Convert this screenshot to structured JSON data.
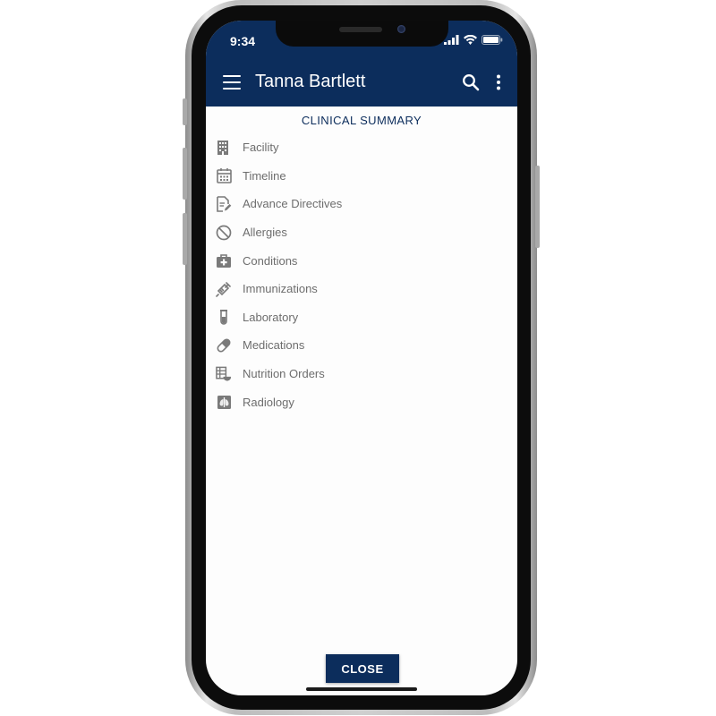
{
  "status_bar": {
    "time": "9:34"
  },
  "app_bar": {
    "title": "Tanna Bartlett",
    "menu_icon": "menu-icon",
    "search_icon": "search-icon",
    "more_icon": "more-vertical-icon"
  },
  "section": {
    "title": "CLINICAL SUMMARY",
    "items": [
      {
        "label": "Facility",
        "icon": "building-icon"
      },
      {
        "label": "Timeline",
        "icon": "calendar-icon"
      },
      {
        "label": "Advance Directives",
        "icon": "document-edit-icon"
      },
      {
        "label": "Allergies",
        "icon": "block-icon"
      },
      {
        "label": "Conditions",
        "icon": "medical-bag-icon"
      },
      {
        "label": "Immunizations",
        "icon": "syringe-icon"
      },
      {
        "label": "Laboratory",
        "icon": "test-tube-icon"
      },
      {
        "label": "Medications",
        "icon": "pill-icon"
      },
      {
        "label": "Nutrition Orders",
        "icon": "nutrition-icon"
      },
      {
        "label": "Radiology",
        "icon": "xray-icon"
      }
    ]
  },
  "footer": {
    "close_label": "CLOSE"
  },
  "colors": {
    "primary": "#0c2d5c",
    "item_text": "#6d6d6d",
    "icon": "#7a7a7a"
  }
}
